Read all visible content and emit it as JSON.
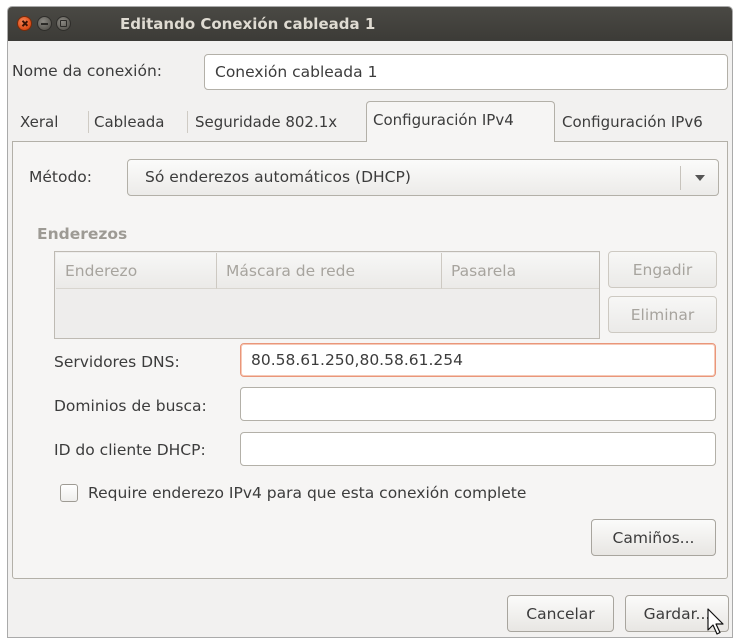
{
  "window": {
    "title": "Editando Conexión cableada 1"
  },
  "connection": {
    "name_label": "Nome da conexión:",
    "name_value": "Conexión cableada 1"
  },
  "tabs": [
    {
      "label": "Xeral",
      "active": false
    },
    {
      "label": "Cableada",
      "active": false
    },
    {
      "label": "Seguridade 802.1x",
      "active": false
    },
    {
      "label": "Configuración IPv4",
      "active": true
    },
    {
      "label": "Configuración IPv6",
      "active": false
    }
  ],
  "ipv4": {
    "method_label": "Método:",
    "method_value": "Só enderezos automáticos (DHCP)",
    "addresses_title": "Enderezos",
    "columns": [
      "Enderezo",
      "Máscara de rede",
      "Pasarela"
    ],
    "add_button": "Engadir",
    "delete_button": "Eliminar",
    "dns_label": "Servidores DNS:",
    "dns_value": "80.58.61.250,80.58.61.254",
    "search_label": "Dominios de busca:",
    "search_value": "",
    "dhcp_label": "ID do cliente DHCP:",
    "dhcp_value": "",
    "require_label": "Require enderezo IPv4 para que esta conexión complete",
    "require_checked": false,
    "routes_button": "Camiños..."
  },
  "footer": {
    "cancel_button": "Cancelar",
    "save_button": "Gardar..."
  },
  "colors": {
    "titlebar": "#3c3b37",
    "close_button": "#e0521d",
    "focus_border": "#e9967a",
    "window_bg": "#f2f1f0"
  }
}
